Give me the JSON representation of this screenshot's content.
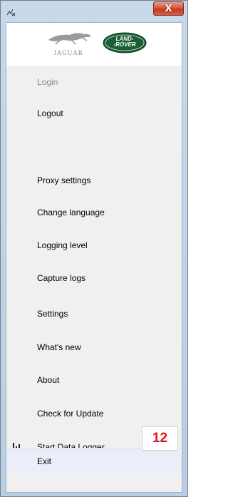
{
  "window": {
    "close_label": "X"
  },
  "logos": {
    "jaguar_text": "JAGUAR",
    "landrover_line1": "LAND-",
    "landrover_line2": "-ROVER"
  },
  "menu": {
    "items": [
      {
        "label": "Login",
        "state": "disabled"
      },
      {
        "label": "Logout",
        "state": "enabled"
      },
      {
        "label": "Proxy settings",
        "state": "enabled"
      },
      {
        "label": "Change language",
        "state": "enabled"
      },
      {
        "label": "Logging level",
        "state": "enabled"
      },
      {
        "label": "Capture logs",
        "state": "enabled"
      },
      {
        "label": "Settings",
        "state": "enabled"
      },
      {
        "label": "What's new",
        "state": "enabled"
      },
      {
        "label": "About",
        "state": "enabled"
      },
      {
        "label": "Check for Update",
        "state": "enabled"
      },
      {
        "label": "Start Data Logger",
        "state": "enabled",
        "icon": "bar-chart-icon"
      },
      {
        "label": "Exit",
        "state": "highlighted"
      }
    ]
  },
  "annotation": {
    "number": "12",
    "color": "#e0141e"
  }
}
